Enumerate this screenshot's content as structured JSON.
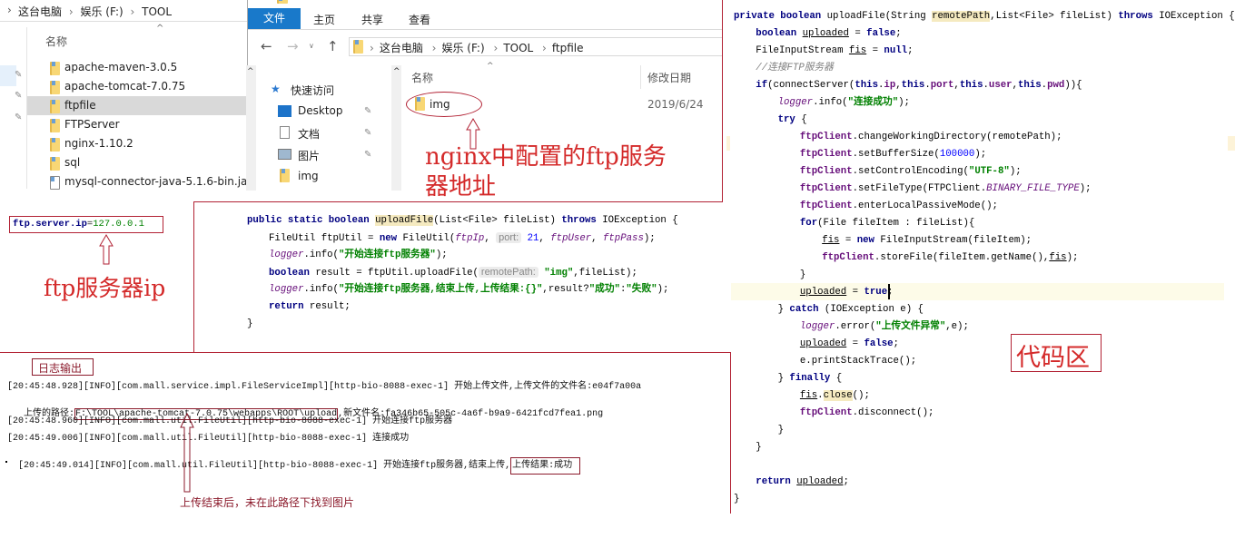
{
  "explorer_left": {
    "breadcrumb": [
      "这台电脑",
      "娱乐 (F:)",
      "TOOL"
    ],
    "column_name": "名称",
    "items": [
      "apache-maven-3.0.5",
      "apache-tomcat-7.0.75",
      "ftpfile",
      "FTPServer",
      "nginx-1.10.2",
      "sql",
      "mysql-connector-java-5.1.6-bin.jar"
    ],
    "selected": "ftpfile"
  },
  "explorer_right": {
    "ribbon_tabs": [
      "文件",
      "主页",
      "共享",
      "查看"
    ],
    "breadcrumb": [
      "这台电脑",
      "娱乐 (F:)",
      "TOOL",
      "ftpfile"
    ],
    "nav": [
      "快速访问",
      "Desktop",
      "文档",
      "图片",
      "img"
    ],
    "columns": [
      "名称",
      "修改日期"
    ],
    "files": [
      {
        "name": "img",
        "date": "2019/6/24"
      }
    ],
    "accent": "#1979ca"
  },
  "annotations": {
    "nginx_line1": "nginx中配置的ftp服务",
    "nginx_line2": "器地址",
    "ftp_ip_label": "ftp服务器ip",
    "code_area": "代码区",
    "log_title": "日志输出",
    "not_found": "上传结束后，未在此路径下找到图片"
  },
  "config": {
    "key": "ftp.server.ip",
    "eq": "=",
    "value": "127.0.0.1"
  },
  "middle_code": {
    "lines": [
      {
        "indent": 0,
        "tokens": [
          [
            "k",
            "public static boolean "
          ],
          [
            "hl",
            "uploadFile"
          ],
          [
            "p",
            "(List<File> fileList) "
          ],
          [
            "k",
            "throws "
          ],
          [
            "p",
            "IOException {"
          ]
        ]
      },
      {
        "indent": 1,
        "tokens": [
          [
            "p",
            "FileUtil ftpUtil = "
          ],
          [
            "k",
            "new "
          ],
          [
            "p",
            "FileUtil("
          ],
          [
            "fi",
            "ftpIp"
          ],
          [
            "p",
            ", "
          ],
          [
            "h",
            "port:"
          ],
          [
            "n",
            " 21"
          ],
          [
            "p",
            ", "
          ],
          [
            "fi",
            "ftpUser"
          ],
          [
            "p",
            ", "
          ],
          [
            "fi",
            "ftpPass"
          ],
          [
            "p",
            ");"
          ]
        ]
      },
      {
        "indent": 1,
        "tokens": [
          [
            "fi",
            "logger"
          ],
          [
            "p",
            ".info("
          ],
          [
            "s",
            "\"开始连接ftp服务器\""
          ],
          [
            "p",
            ");"
          ]
        ]
      },
      {
        "indent": 1,
        "tokens": [
          [
            "k",
            "boolean "
          ],
          [
            "p",
            "result = ftpUtil.uploadFile("
          ],
          [
            "h",
            "remotePath:"
          ],
          [
            "s",
            " \"img\""
          ],
          [
            "p",
            ",fileList);"
          ]
        ]
      },
      {
        "indent": 1,
        "tokens": [
          [
            "fi",
            "logger"
          ],
          [
            "p",
            ".info("
          ],
          [
            "s",
            "\"开始连接ftp服务器,结束上传,上传结果:{}\""
          ],
          [
            "p",
            ",result?"
          ],
          [
            "s",
            "\"成功\""
          ],
          [
            "p",
            ":"
          ],
          [
            "s",
            "\"失败\""
          ],
          [
            "p",
            ");"
          ]
        ]
      },
      {
        "indent": 1,
        "tokens": [
          [
            "k",
            "return "
          ],
          [
            "p",
            "result;"
          ]
        ]
      },
      {
        "indent": 0,
        "tokens": [
          [
            "p",
            "}"
          ]
        ]
      }
    ]
  },
  "right_code": {
    "lines": [
      {
        "indent": 0,
        "tokens": [
          [
            "k",
            "private boolean "
          ],
          [
            "p",
            "uploadFile(String "
          ],
          [
            "hl",
            "remotePath"
          ],
          [
            "p",
            ",List<File> fileList) "
          ],
          [
            "k",
            "throws "
          ],
          [
            "p",
            "IOException {"
          ]
        ]
      },
      {
        "indent": 1,
        "tokens": [
          [
            "k",
            "boolean "
          ],
          [
            "u",
            "uploaded"
          ],
          [
            "p",
            " = "
          ],
          [
            "k",
            "false"
          ],
          [
            "p",
            ";"
          ]
        ]
      },
      {
        "indent": 1,
        "tokens": [
          [
            "p",
            "FileInputStream "
          ],
          [
            "u",
            "fis"
          ],
          [
            "p",
            " = "
          ],
          [
            "k",
            "null"
          ],
          [
            "p",
            ";"
          ]
        ]
      },
      {
        "indent": 1,
        "tokens": [
          [
            "c",
            "//连接FTP服务器"
          ]
        ]
      },
      {
        "indent": 1,
        "tokens": [
          [
            "k",
            "if"
          ],
          [
            "p",
            "(connectServer("
          ],
          [
            "k",
            "this"
          ],
          [
            "p",
            "."
          ],
          [
            "f",
            "ip"
          ],
          [
            "p",
            ","
          ],
          [
            "k",
            "this"
          ],
          [
            "p",
            "."
          ],
          [
            "f",
            "port"
          ],
          [
            "p",
            ","
          ],
          [
            "k",
            "this"
          ],
          [
            "p",
            "."
          ],
          [
            "f",
            "user"
          ],
          [
            "p",
            ","
          ],
          [
            "k",
            "this"
          ],
          [
            "p",
            "."
          ],
          [
            "f",
            "pwd"
          ],
          [
            "p",
            ")){"
          ]
        ]
      },
      {
        "indent": 2,
        "tokens": [
          [
            "fi",
            "logger"
          ],
          [
            "p",
            ".info("
          ],
          [
            "s",
            "\"连接成功\""
          ],
          [
            "p",
            ");"
          ]
        ]
      },
      {
        "indent": 2,
        "tokens": [
          [
            "k",
            "try "
          ],
          [
            "p",
            "{"
          ]
        ]
      },
      {
        "indent": 3,
        "tokens": [
          [
            "f",
            "ftpClient"
          ],
          [
            "p",
            ".changeWorkingDirectory(remotePath);"
          ]
        ]
      },
      {
        "indent": 3,
        "tokens": [
          [
            "f",
            "ftpClient"
          ],
          [
            "p",
            ".setBufferSize("
          ],
          [
            "n",
            "100000"
          ],
          [
            "p",
            ");"
          ]
        ]
      },
      {
        "indent": 3,
        "tokens": [
          [
            "f",
            "ftpClient"
          ],
          [
            "p",
            ".setControlEncoding("
          ],
          [
            "s",
            "\"UTF-8\""
          ],
          [
            "p",
            ");"
          ]
        ]
      },
      {
        "indent": 3,
        "tokens": [
          [
            "f",
            "ftpClient"
          ],
          [
            "p",
            ".setFileType(FTPClient."
          ],
          [
            "fi",
            "BINARY_FILE_TYPE"
          ],
          [
            "p",
            ");"
          ]
        ]
      },
      {
        "indent": 3,
        "tokens": [
          [
            "f",
            "ftpClient"
          ],
          [
            "p",
            ".enterLocalPassiveMode();"
          ]
        ]
      },
      {
        "indent": 3,
        "tokens": [
          [
            "k",
            "for"
          ],
          [
            "p",
            "(File fileItem : fileList){"
          ]
        ]
      },
      {
        "indent": 4,
        "tokens": [
          [
            "u",
            "fis"
          ],
          [
            "p",
            " = "
          ],
          [
            "k",
            "new "
          ],
          [
            "p",
            "FileInputStream(fileItem);"
          ]
        ]
      },
      {
        "indent": 4,
        "tokens": [
          [
            "f",
            "ftpClient"
          ],
          [
            "p",
            ".storeFile(fileItem.getName(),"
          ],
          [
            "u",
            "fis"
          ],
          [
            "p",
            ");"
          ]
        ]
      },
      {
        "indent": 3,
        "tokens": [
          [
            "p",
            "}"
          ]
        ]
      },
      {
        "indent": 3,
        "tokens": [
          [
            "u",
            "uploaded"
          ],
          [
            "p",
            " = "
          ],
          [
            "k",
            "true"
          ],
          [
            "p",
            ";"
          ]
        ]
      },
      {
        "indent": 2,
        "tokens": [
          [
            "p",
            "} "
          ],
          [
            "k",
            "catch "
          ],
          [
            "p",
            "(IOException e) {"
          ]
        ]
      },
      {
        "indent": 3,
        "tokens": [
          [
            "fi",
            "logger"
          ],
          [
            "p",
            ".error("
          ],
          [
            "s",
            "\"上传文件异常\""
          ],
          [
            "p",
            ",e);"
          ]
        ]
      },
      {
        "indent": 3,
        "tokens": [
          [
            "u",
            "uploaded"
          ],
          [
            "p",
            " = "
          ],
          [
            "k",
            "false"
          ],
          [
            "p",
            ";"
          ]
        ]
      },
      {
        "indent": 3,
        "tokens": [
          [
            "p",
            "e.printStackTrace();"
          ]
        ]
      },
      {
        "indent": 2,
        "tokens": [
          [
            "p",
            "} "
          ],
          [
            "k",
            "finally "
          ],
          [
            "p",
            "{"
          ]
        ]
      },
      {
        "indent": 3,
        "tokens": [
          [
            "u",
            "fis"
          ],
          [
            "p",
            "."
          ],
          [
            "hl",
            "close"
          ],
          [
            "p",
            "();"
          ]
        ]
      },
      {
        "indent": 3,
        "tokens": [
          [
            "f",
            "ftpClient"
          ],
          [
            "p",
            ".disconnect();"
          ]
        ]
      },
      {
        "indent": 2,
        "tokens": [
          [
            "p",
            "}"
          ]
        ]
      },
      {
        "indent": 1,
        "tokens": [
          [
            "p",
            "}"
          ]
        ]
      },
      {
        "indent": 1,
        "tokens": []
      },
      {
        "indent": 1,
        "tokens": [
          [
            "k",
            "return "
          ],
          [
            "u",
            "uploaded"
          ],
          [
            "p",
            ";"
          ]
        ]
      },
      {
        "indent": 0,
        "tokens": [
          [
            "p",
            "}"
          ]
        ]
      }
    ]
  },
  "log": {
    "line1": "[20:45:48.928][INFO][com.mall.service.impl.FileServiceImpl][http-bio-8088-exec-1] 开始上传文件,上传文件的文件名:e04f7a00a",
    "line2_prefix": " 上传的路径:",
    "line2_path": "F:\\TOOL\\apache-tomcat-7.0.75\\webapps\\ROOT\\upload",
    "line2_suffix": ",新文件名:fa346b65-505c-4a6f-b9a9-6421fcd7fea1.png",
    "line3": "[20:45:48.960][INFO][com.mall.util.FileUtil][http-bio-8088-exec-1] 开始连接ftp服务器",
    "line4": "[20:45:49.006][INFO][com.mall.util.FileUtil][http-bio-8088-exec-1] 连接成功",
    "line5_prefix": "[20:45:49.014][INFO][com.mall.util.FileUtil][http-bio-8088-exec-1] 开始连接ftp服务器,结束上传,",
    "line5_result": "上传结果:成功"
  }
}
